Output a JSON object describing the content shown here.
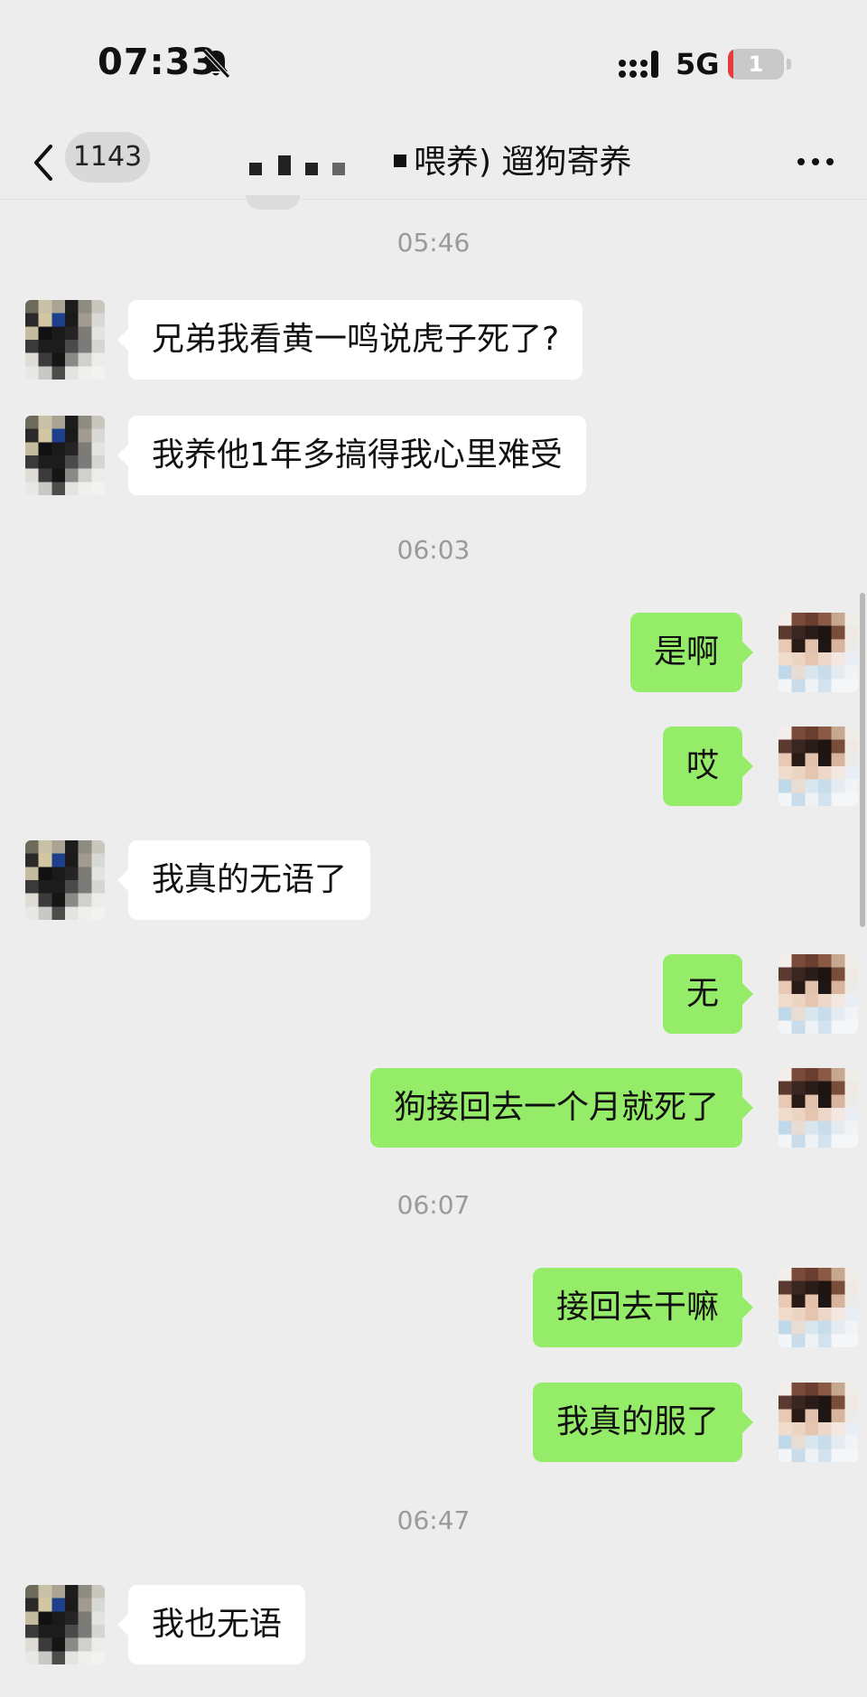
{
  "status_bar": {
    "time": "07:33",
    "network": "5G",
    "battery_level": "1",
    "battery_fraction": 0.01,
    "icons": [
      "bell-muted-icon",
      "signal-icon",
      "battery-icon"
    ]
  },
  "nav": {
    "unread_count": "1143",
    "title": "喂养) 遛狗寄养",
    "back_icon": "chevron-left-icon",
    "more_icon": "more-dots-icon"
  },
  "colors": {
    "background": "#ededed",
    "incoming_bubble": "#ffffff",
    "outgoing_bubble": "#95ec69",
    "timestamp": "#9a9a9a"
  },
  "messages": [
    {
      "type": "time",
      "text": "05:46"
    },
    {
      "type": "msg",
      "dir": "in",
      "text": "兄弟我看黄一鸣说虎子死了?"
    },
    {
      "type": "msg",
      "dir": "in",
      "text": "我养他1年多搞得我心里难受"
    },
    {
      "type": "time",
      "text": "06:03"
    },
    {
      "type": "msg",
      "dir": "out",
      "text": "是啊"
    },
    {
      "type": "msg",
      "dir": "out",
      "text": "哎"
    },
    {
      "type": "msg",
      "dir": "in",
      "text": "我真的无语了"
    },
    {
      "type": "msg",
      "dir": "out",
      "text": "无"
    },
    {
      "type": "msg",
      "dir": "out",
      "text": "狗接回去一个月就死了"
    },
    {
      "type": "time",
      "text": "06:07"
    },
    {
      "type": "msg",
      "dir": "out",
      "text": "接回去干嘛"
    },
    {
      "type": "msg",
      "dir": "out",
      "text": "我真的服了"
    },
    {
      "type": "time",
      "text": "06:47"
    },
    {
      "type": "msg",
      "dir": "in",
      "text": "我也无语"
    }
  ]
}
